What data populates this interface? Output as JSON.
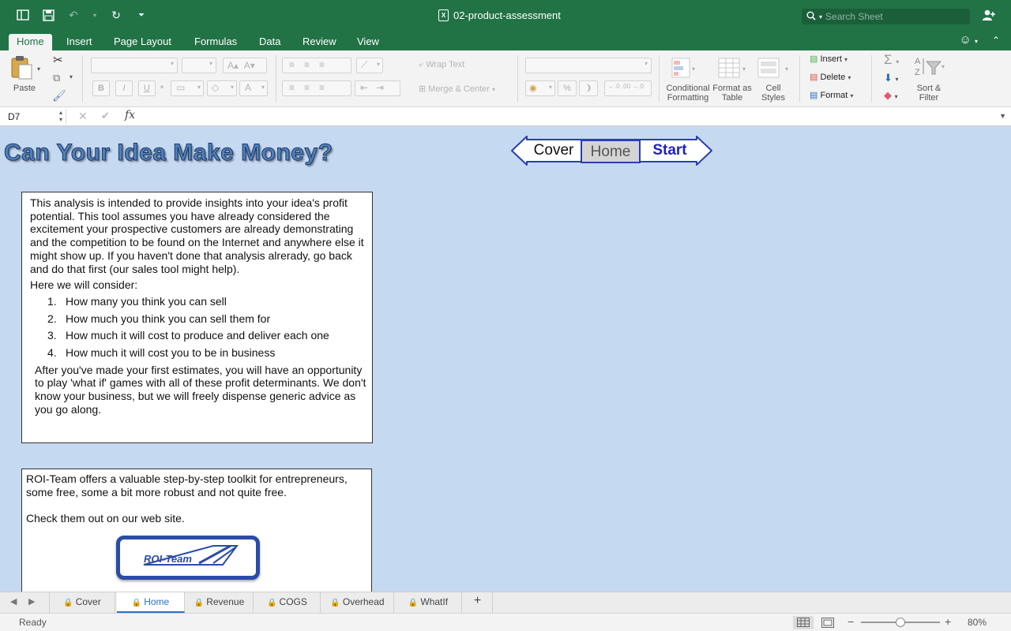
{
  "app": {
    "document_title": "02-product-assessment",
    "search_placeholder": "Search Sheet"
  },
  "ribbon_tabs": [
    "Home",
    "Insert",
    "Page Layout",
    "Formulas",
    "Data",
    "Review",
    "View"
  ],
  "active_tab": "Home",
  "ribbon": {
    "paste_label": "Paste",
    "wrap_text": "Wrap Text",
    "merge_center": "Merge & Center",
    "bold": "B",
    "italic": "I",
    "underline": "U",
    "percent": "%",
    "conditional_formatting": "Conditional Formatting",
    "format_as_table": "Format as Table",
    "cell_styles": "Cell Styles",
    "insert": "Insert",
    "delete": "Delete",
    "format": "Format",
    "sort_filter": "Sort & Filter"
  },
  "formula_bar": {
    "name_box": "D7",
    "fx": "fx",
    "value": ""
  },
  "sheet": {
    "headline": "Can Your Idea Make Money?",
    "nav": {
      "cover": "Cover",
      "home": "Home",
      "start": "Start"
    },
    "intro": {
      "paragraph": "This analysis is intended to provide insights into your idea's profit potential. This tool assumes you have already considered the excitement your prospective customers are already demonstrating and the competition to be found on the Internet and anywhere else it might show up. If you haven't done that analysis alrerady, go back and do that first (our sales tool might help).",
      "list_intro": "Here we will consider:",
      "items": [
        {
          "num": "1.",
          "text": "How many you think you can sell"
        },
        {
          "num": "2.",
          "text": "How much you think you can sell them for"
        },
        {
          "num": "3.",
          "text": "How much it will cost to produce and deliver each one"
        },
        {
          "num": "4.",
          "text": "How much it will cost you to be in business"
        }
      ],
      "after": "After you've made your first estimates, you will have an opportunity to play 'what if' games with all of these profit determinants. We don't know your business, but we will freely dispense generic advice as you go along."
    },
    "promo": {
      "line1": "ROI-Team offers a valuable step-by-step toolkit for entrepreneurs, some free, some a bit more robust and not quite free.",
      "line2": "Check them out on our web site.",
      "logo_text": "ROI-Team"
    }
  },
  "sheet_tabs": [
    {
      "label": "Cover",
      "locked": true
    },
    {
      "label": "Home",
      "locked": true,
      "active": true
    },
    {
      "label": "Revenue",
      "locked": true
    },
    {
      "label": "COGS",
      "locked": true
    },
    {
      "label": "Overhead",
      "locked": true
    },
    {
      "label": "WhatIf",
      "locked": true
    }
  ],
  "status": {
    "ready": "Ready",
    "zoom": "80%",
    "zoom_fraction": 0.5
  },
  "colors": {
    "excel_green": "#217346",
    "sheet_bg": "#c5d9f1",
    "headline_blue": "#4f81bd",
    "start_blue": "#1f1fc8",
    "logo_blue": "#2a4ca8"
  }
}
